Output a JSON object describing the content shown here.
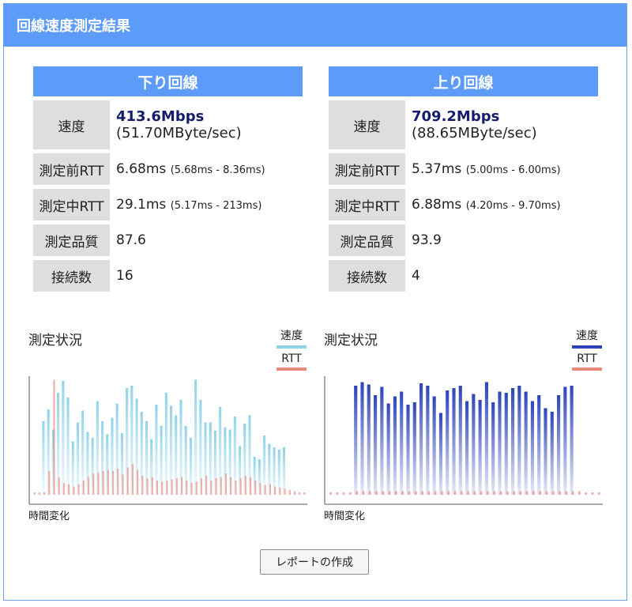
{
  "header": {
    "title": "回線速度測定結果"
  },
  "download": {
    "heading": "下り回線",
    "speed_label": "速度",
    "speed_main": "413.6Mbps",
    "speed_sub": "(51.70MByte/sec)",
    "rtt_before_label": "測定前RTT",
    "rtt_before_main": "6.68ms",
    "rtt_before_range": "(5.68ms - 8.36ms)",
    "rtt_during_label": "測定中RTT",
    "rtt_during_main": "29.1ms",
    "rtt_during_range": "(5.17ms - 213ms)",
    "quality_label": "測定品質",
    "quality": "87.6",
    "connections_label": "接続数",
    "connections": "16"
  },
  "upload": {
    "heading": "上り回線",
    "speed_label": "速度",
    "speed_main": "709.2Mbps",
    "speed_sub": "(88.65MByte/sec)",
    "rtt_before_label": "測定前RTT",
    "rtt_before_main": "5.37ms",
    "rtt_before_range": "(5.00ms - 6.00ms)",
    "rtt_during_label": "測定中RTT",
    "rtt_during_main": "6.88ms",
    "rtt_during_range": "(4.20ms - 9.70ms)",
    "quality_label": "測定品質",
    "quality": "93.9",
    "connections_label": "接続数",
    "connections": "4"
  },
  "colors": {
    "header_blue": "#5c9bf7",
    "label_gray": "#dedede",
    "speed_text": "#141d6b",
    "down_speed": "#8fd3ea",
    "up_speed": "#2d45b8",
    "rtt": "#e8897c"
  },
  "chart_data": [
    {
      "type": "bar",
      "title": "測定状況",
      "xlabel": "時間変化",
      "legend": [
        "速度",
        "RTT"
      ],
      "legend_position": "top-right",
      "series": [
        {
          "name": "速度",
          "color": "#8fd3ea",
          "values": [
            0,
            0,
            0.62,
            0.72,
            0.55,
            0.86,
            0.96,
            0.82,
            0.45,
            0.61,
            0.71,
            0.53,
            0.48,
            0.79,
            0.62,
            0.51,
            0.65,
            0.77,
            0.52,
            0.9,
            0.92,
            0.81,
            0.7,
            0.62,
            0.47,
            0.76,
            0.58,
            0.86,
            0.75,
            0.67,
            0.8,
            0.58,
            0.48,
            0.97,
            0.8,
            0.61,
            0.61,
            0.54,
            0.74,
            0.57,
            0.55,
            0.66,
            0.41,
            0.6,
            0.67,
            0.32,
            0.3,
            0.5,
            0.43,
            0.4,
            0.38,
            0.4,
            0,
            0,
            0,
            0
          ]
        },
        {
          "name": "RTT",
          "color": "#e8897c",
          "values": [
            0.02,
            0.02,
            0.02,
            0.2,
            0.97,
            0.15,
            0.1,
            0.09,
            0.07,
            0.09,
            0.12,
            0.15,
            0.18,
            0.19,
            0.2,
            0.21,
            0.2,
            0.22,
            0.17,
            0.23,
            0.26,
            0.21,
            0.16,
            0.14,
            0.15,
            0.12,
            0.11,
            0.12,
            0.13,
            0.14,
            0.15,
            0.12,
            0.1,
            0.11,
            0.14,
            0.16,
            0.12,
            0.14,
            0.15,
            0.18,
            0.15,
            0.12,
            0.14,
            0.16,
            0.15,
            0.12,
            0.1,
            0.08,
            0.09,
            0.07,
            0.06,
            0.05,
            0.04,
            0.03,
            0.02,
            0.02
          ]
        }
      ]
    },
    {
      "type": "bar",
      "title": "測定状況",
      "xlabel": "時間変化",
      "legend": [
        "速度",
        "RTT"
      ],
      "legend_position": "top-right",
      "series": [
        {
          "name": "速度",
          "color": "#2d45b8",
          "values": [
            0,
            0,
            0,
            0,
            0.92,
            0.95,
            0.93,
            0.84,
            0.91,
            0.77,
            0.83,
            0.87,
            0.76,
            0.78,
            0.94,
            0.92,
            0.83,
            0.69,
            0.88,
            0.9,
            0.92,
            0.79,
            0.85,
            0.8,
            0.95,
            0.78,
            0.87,
            0.86,
            0.9,
            0.92,
            0.87,
            0.79,
            0.84,
            0.73,
            0.7,
            0.84,
            0.91,
            0.92,
            0,
            0,
            0,
            0
          ]
        },
        {
          "name": "RTT",
          "color": "#e8897c",
          "values": [
            0.02,
            0.02,
            0.02,
            0.02,
            0.03,
            0.03,
            0.03,
            0.03,
            0.03,
            0.03,
            0.03,
            0.03,
            0.03,
            0.03,
            0.03,
            0.03,
            0.03,
            0.03,
            0.03,
            0.03,
            0.03,
            0.03,
            0.03,
            0.03,
            0.03,
            0.03,
            0.03,
            0.03,
            0.03,
            0.03,
            0.03,
            0.03,
            0.03,
            0.03,
            0.03,
            0.03,
            0.03,
            0.03,
            0.03,
            0.02,
            0.02,
            0.02
          ]
        }
      ]
    }
  ],
  "actions": {
    "report_label": "レポートの作成"
  }
}
